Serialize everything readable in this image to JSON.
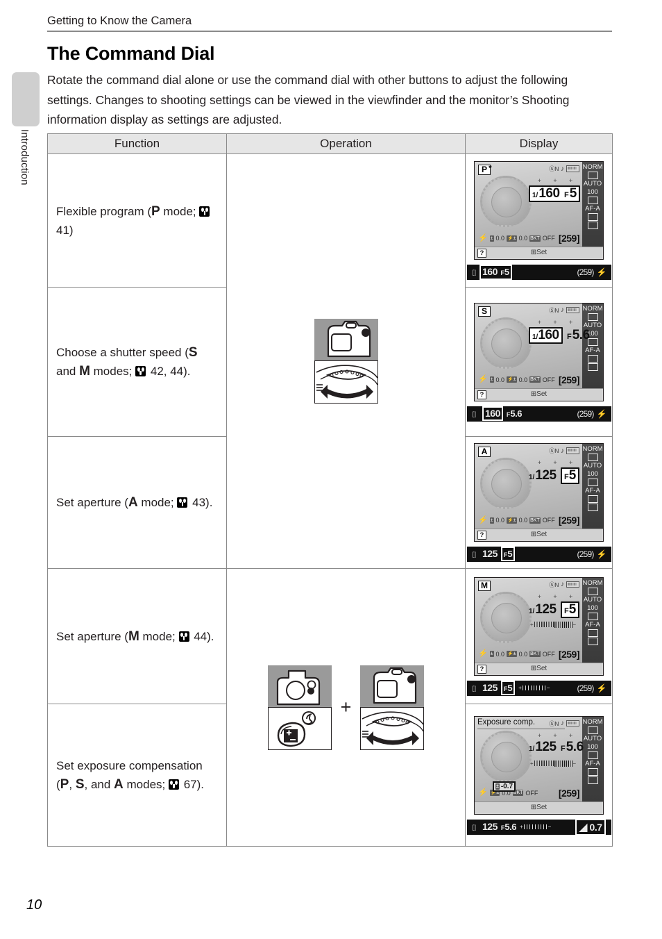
{
  "page": {
    "running_head": "Getting to Know the Camera",
    "title": "The Command Dial",
    "intro": "Rotate the command dial alone or use the command dial with other buttons to adjust the following settings. Changes to shooting settings can be viewed in the viewfinder and the monitor’s Shooting information display as settings are adjusted.",
    "side_tab_label": "Introduction",
    "page_number": "10"
  },
  "table": {
    "headers": {
      "function": "Function",
      "operation": "Operation",
      "display": "Display"
    },
    "rows": [
      {
        "function_pre": "Flexible program (",
        "function_mode": "P",
        "function_mid": " mode;",
        "function_ref": " 41)",
        "display": {
          "mode": "P",
          "star": "*",
          "wb": "N",
          "shutter_prefix": "1/",
          "shutter": "160",
          "aperture_prefix": "F",
          "aperture": "5",
          "shutter_boxed": true,
          "aperture_boxed": true,
          "group_boxed": true,
          "meter": false,
          "exp_comp": "0.0",
          "flash_comp": "0.0",
          "bracket": "OFF",
          "shots": "[259]",
          "set_label": "Set",
          "help": "?",
          "side": [
            "NORM",
            "AUTO",
            "100",
            "AF-A"
          ],
          "title": ""
        },
        "viewfinder": {
          "speed": "160",
          "f_prefix": "F",
          "f_value": "5",
          "speed_boxed": true,
          "f_boxed": true,
          "group_boxed": true,
          "shots": "(259)",
          "meter": false,
          "exp_comp": ""
        }
      },
      {
        "function_pre": "Choose a shutter speed (",
        "function_mode": "S",
        "function_mid": " and ",
        "function_mode2": "M",
        "function_mid2": " modes;",
        "function_ref": " 42, 44).",
        "display": {
          "mode": "S",
          "star": "",
          "wb": "N",
          "shutter_prefix": "1/",
          "shutter": "160",
          "aperture_prefix": "F",
          "aperture": "5.6",
          "shutter_boxed": true,
          "aperture_boxed": false,
          "group_boxed": false,
          "meter": false,
          "exp_comp": "0.0",
          "flash_comp": "0.0",
          "bracket": "OFF",
          "shots": "[259]",
          "set_label": "Set",
          "help": "?",
          "side": [
            "NORM",
            "AUTO",
            "100",
            "AF-A"
          ],
          "title": ""
        },
        "viewfinder": {
          "speed": "160",
          "f_prefix": "F",
          "f_value": "5.6",
          "speed_boxed": true,
          "f_boxed": false,
          "group_boxed": false,
          "shots": "(259)",
          "meter": false,
          "exp_comp": ""
        }
      },
      {
        "function_pre": "Set aperture (",
        "function_mode": "A",
        "function_mid": " mode;",
        "function_ref": " 43).",
        "display": {
          "mode": "A",
          "star": "",
          "wb": "N",
          "shutter_prefix": "1/",
          "shutter": "125",
          "aperture_prefix": "F",
          "aperture": "5",
          "shutter_boxed": false,
          "aperture_boxed": true,
          "group_boxed": false,
          "meter": false,
          "exp_comp": "0.0",
          "flash_comp": "0.0",
          "bracket": "OFF",
          "shots": "[259]",
          "set_label": "Set",
          "help": "?",
          "side": [
            "NORM",
            "AUTO",
            "100",
            "AF-A"
          ],
          "title": ""
        },
        "viewfinder": {
          "speed": "125",
          "f_prefix": "F",
          "f_value": "5",
          "speed_boxed": false,
          "f_boxed": true,
          "group_boxed": false,
          "shots": "(259)",
          "meter": false,
          "exp_comp": ""
        }
      },
      {
        "function_pre": "Set aperture (",
        "function_mode": "M",
        "function_mid": " mode;",
        "function_ref": " 44).",
        "display": {
          "mode": "M",
          "star": "",
          "wb": "N",
          "shutter_prefix": "1/",
          "shutter": "125",
          "aperture_prefix": "F",
          "aperture": "5",
          "shutter_boxed": false,
          "aperture_boxed": true,
          "group_boxed": false,
          "meter": true,
          "exp_comp": "0.0",
          "flash_comp": "0.0",
          "bracket": "OFF",
          "shots": "[259]",
          "set_label": "Set",
          "help": "?",
          "side": [
            "NORM",
            "AUTO",
            "100",
            "AF-A"
          ],
          "title": ""
        },
        "viewfinder": {
          "speed": "125",
          "f_prefix": "F",
          "f_value": "5",
          "speed_boxed": false,
          "f_boxed": true,
          "group_boxed": false,
          "shots": "(259)",
          "meter": true,
          "exp_comp": ""
        }
      },
      {
        "function_pre": "Set exposure compensation (",
        "function_mode": "P",
        "function_mid": ", ",
        "function_mode2": "S",
        "function_mid2": ", and ",
        "function_mode3": "A",
        "function_mid3": " modes;",
        "function_ref": " 67).",
        "display": {
          "mode": "",
          "star": "",
          "wb": "N",
          "shutter_prefix": "1/",
          "shutter": "125",
          "aperture_prefix": "F",
          "aperture": "5.6",
          "shutter_boxed": false,
          "aperture_boxed": false,
          "group_boxed": false,
          "meter": true,
          "exp_comp": "-0.7",
          "flash_comp": "0.0",
          "bracket": "OFF",
          "shots": "[259]",
          "set_label": "Set",
          "help": "",
          "side": [
            "NORM",
            "AUTO",
            "100",
            "AF-A"
          ],
          "title": "Exposure comp."
        },
        "viewfinder": {
          "speed": "125",
          "f_prefix": "F",
          "f_value": "5.6",
          "speed_boxed": false,
          "f_boxed": false,
          "group_boxed": false,
          "shots": "",
          "meter": true,
          "exp_comp": "0.7"
        }
      }
    ],
    "operation": {
      "dial_only_caption": "",
      "plus_symbol": "+"
    }
  },
  "colors": {
    "rule": "#8a8a8a",
    "header_fill": "#e6e6e6",
    "tab_fill": "#cfcfcf",
    "text": "#231f20"
  }
}
